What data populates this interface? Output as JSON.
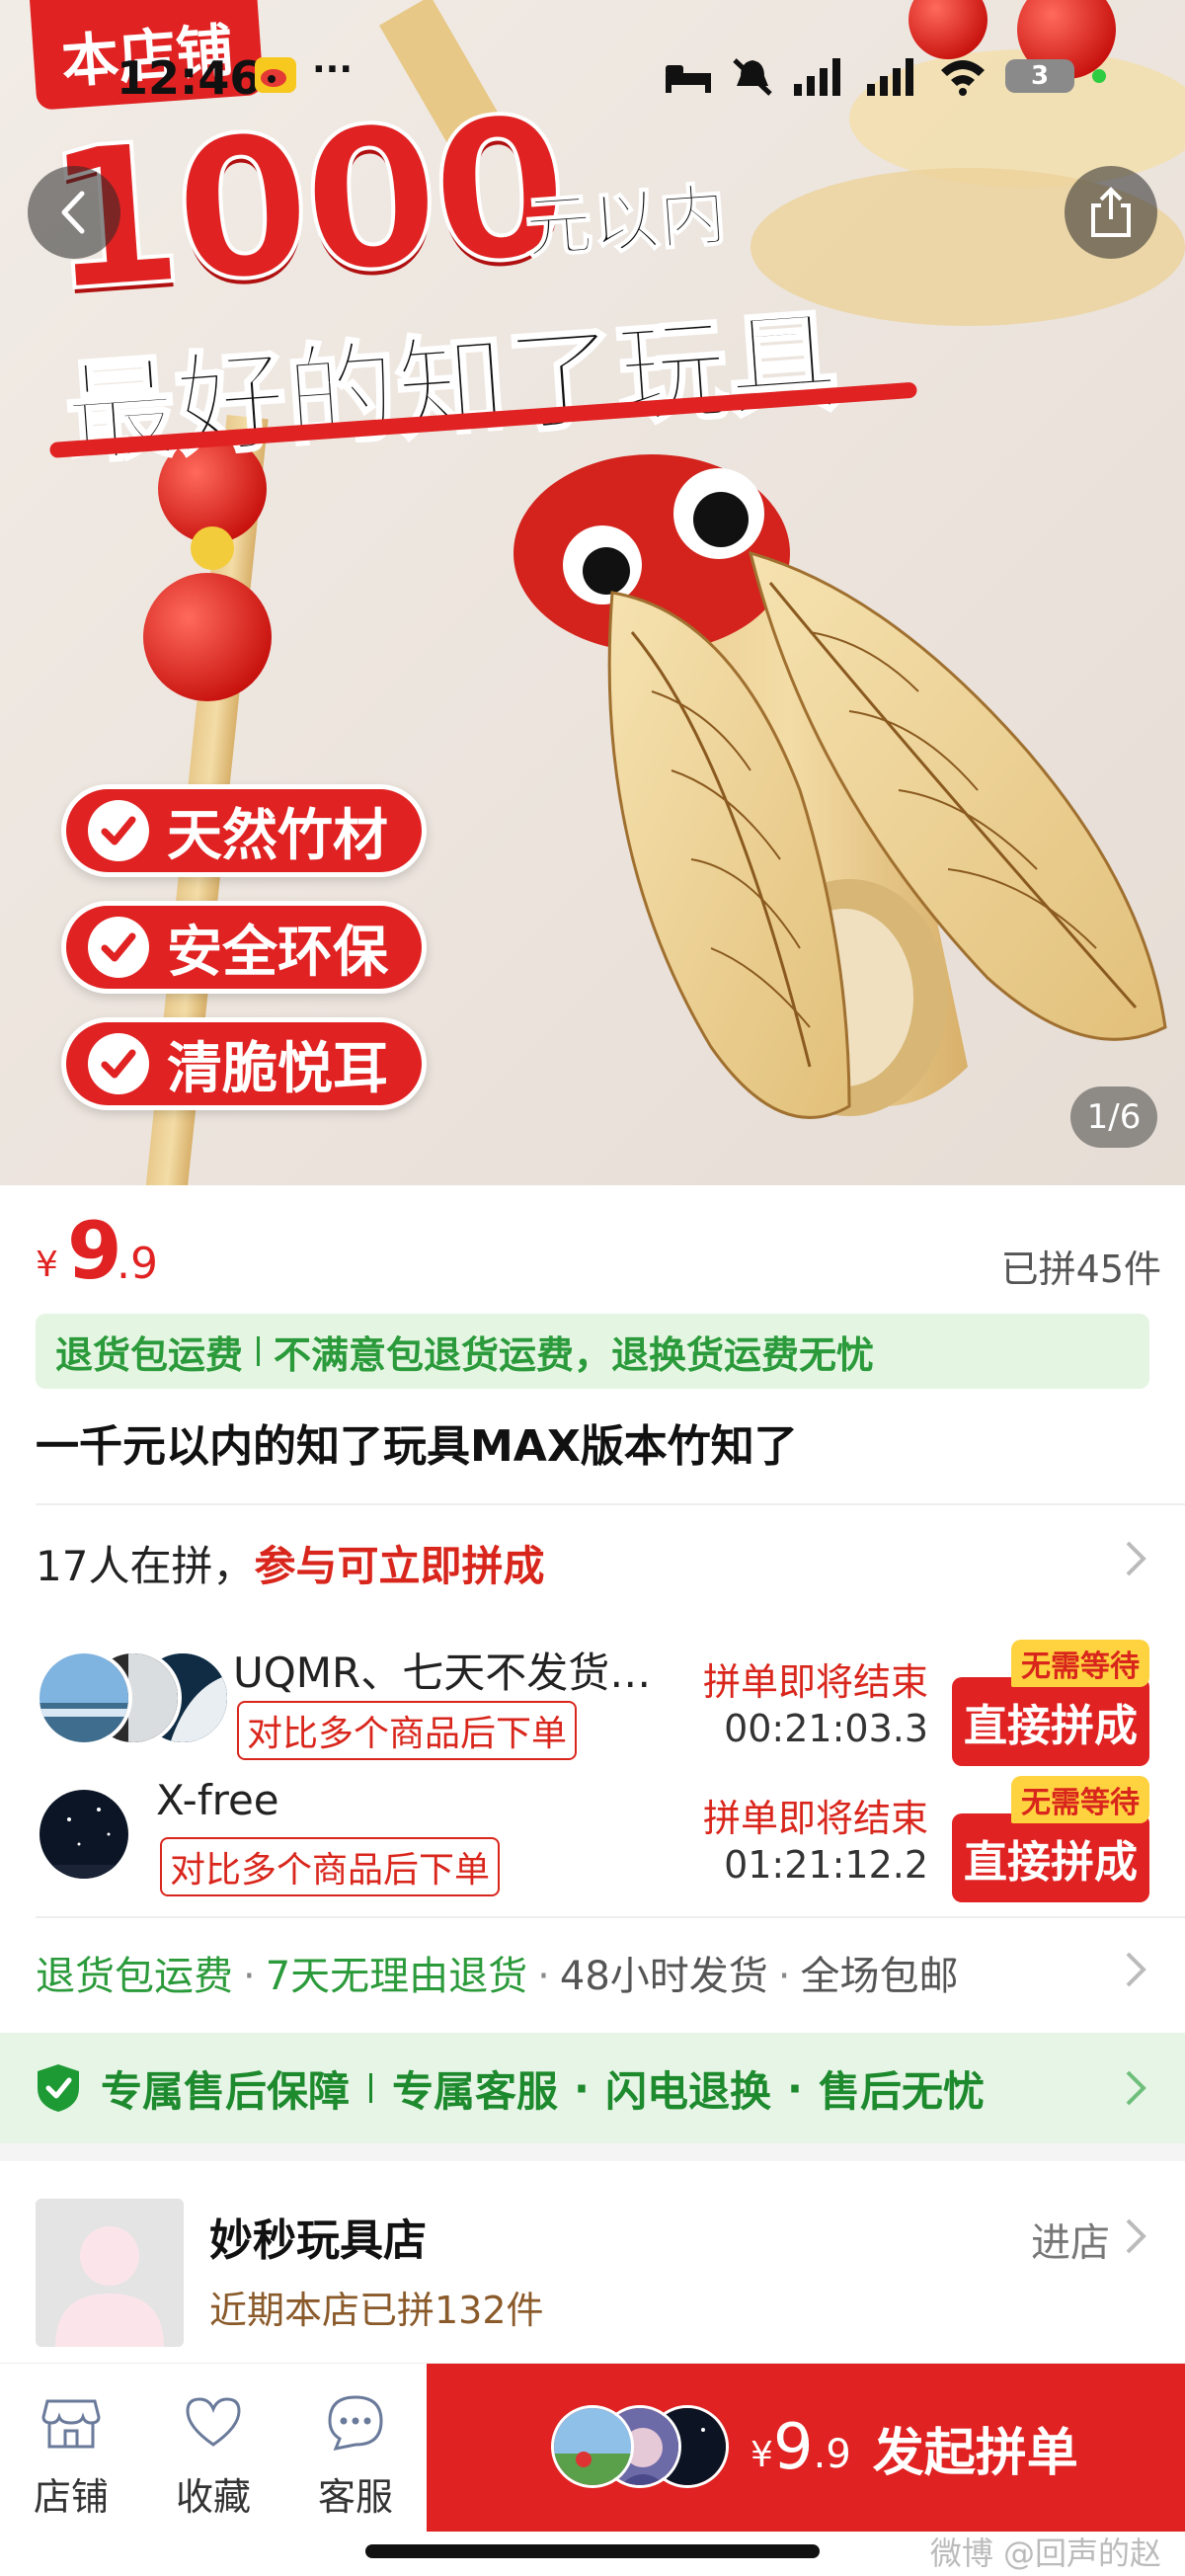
{
  "status_bar": {
    "time": "12:46",
    "dots": "···",
    "battery": "3"
  },
  "hero": {
    "store_tag": "本店铺",
    "headline_number": "1000",
    "headline_unit": "元以内",
    "headline_line2": "最好的知了玩具",
    "features": [
      "天然竹材",
      "安全环保",
      "清脆悦耳"
    ],
    "page_counter": "1/6"
  },
  "price": {
    "symbol": "¥",
    "integer": "9",
    "decimal": ".9",
    "joined_count": "已拼45件"
  },
  "service_bar": {
    "part1": "退货包运费",
    "part2": "不满意包退货运费，退换货运费无忧"
  },
  "product_title": "一千元以内的知了玩具MAX版本竹知了",
  "group_buy": {
    "header_normal": "17人在拼，",
    "header_highlight": "参与可立即拼成",
    "groups": [
      {
        "user": "UQMR、七天不发货…",
        "compare_tag": "对比多个商品后下单",
        "status": "拼单即将结束",
        "timer": "00:21:03.3",
        "badge": "无需等待",
        "button": "直接拼成"
      },
      {
        "user": "X-free",
        "compare_tag": "对比多个商品后下单",
        "status": "拼单即将结束",
        "timer": "01:21:12.2",
        "badge": "无需等待",
        "button": "直接拼成"
      }
    ]
  },
  "guarantees": {
    "items_green": [
      "退货包运费",
      "7天无理由退货"
    ],
    "items_gray": [
      "48小时发货",
      "全场包邮"
    ],
    "dot": "·"
  },
  "after_sale": {
    "label": "专属售后保障",
    "items": [
      "专属客服",
      "闪电退换",
      "售后无忧"
    ],
    "dot": "·"
  },
  "shop": {
    "name": "妙秒玩具店",
    "recent": "近期本店已拼132件",
    "enter": "进店"
  },
  "bottom_bar": {
    "tabs": [
      {
        "label": "店铺",
        "icon": "store-icon"
      },
      {
        "label": "收藏",
        "icon": "heart-icon"
      },
      {
        "label": "客服",
        "icon": "chat-icon"
      }
    ],
    "launch": {
      "symbol": "¥",
      "integer": "9",
      "decimal": ".9",
      "label": "发起拼单"
    }
  },
  "watermark": "微博 @回声的赵",
  "colors": {
    "brand_red": "#e02222",
    "service_green": "#2a9a3a",
    "after_sale_bg": "#e7f5e7",
    "badge_yellow": "#ffd23f"
  }
}
